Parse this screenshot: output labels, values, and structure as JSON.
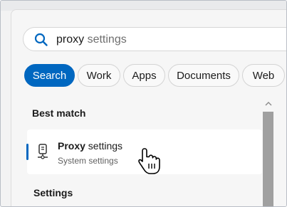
{
  "search": {
    "typed": "proxy",
    "suggestion": " settings"
  },
  "filters": [
    {
      "label": "Search",
      "active": true
    },
    {
      "label": "Work",
      "active": false
    },
    {
      "label": "Apps",
      "active": false
    },
    {
      "label": "Documents",
      "active": false
    },
    {
      "label": "Web",
      "active": false
    }
  ],
  "best_match": {
    "heading": "Best match",
    "title_bold": "Proxy",
    "title_rest": " settings",
    "subtitle": "System settings",
    "icon": "proxy-settings-icon"
  },
  "settings_section": {
    "heading": "Settings"
  },
  "colors": {
    "accent": "#0067c0",
    "scroll_thumb": "#a0a0a0"
  }
}
